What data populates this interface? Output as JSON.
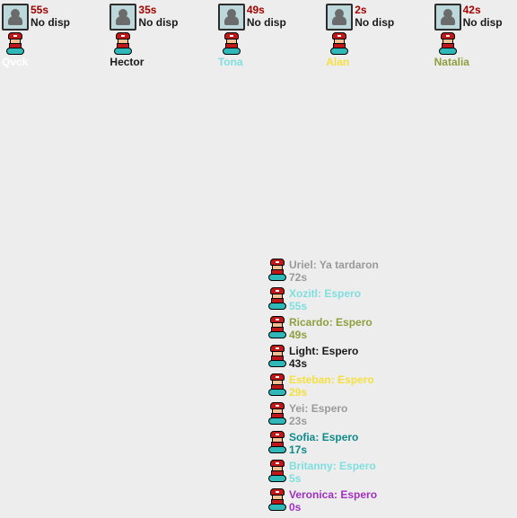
{
  "top_players": [
    {
      "time": "55s",
      "disp": "No disp",
      "name": "Qvck",
      "color": "c-white"
    },
    {
      "time": "35s",
      "disp": "No disp",
      "name": "Hector",
      "color": "c-black"
    },
    {
      "time": "49s",
      "disp": "No disp",
      "name": "Tona",
      "color": "c-cyan"
    },
    {
      "time": "2s",
      "disp": "No disp",
      "name": "Alan",
      "color": "c-yellow"
    },
    {
      "time": "42s",
      "disp": "No disp",
      "name": "Natalia",
      "color": "c-olive"
    }
  ],
  "queue": [
    {
      "name": "Uriel",
      "msg": "Ya tardaron",
      "time": "72s",
      "color": "c-gray"
    },
    {
      "name": "Xozitl",
      "msg": "Espero",
      "time": "55s",
      "color": "c-cyan"
    },
    {
      "name": "Ricardo",
      "msg": "Espero",
      "time": "49s",
      "color": "c-olive"
    },
    {
      "name": "Light",
      "msg": "Espero",
      "time": "43s",
      "color": "c-black"
    },
    {
      "name": "Esteban",
      "msg": "Espero",
      "time": "29s",
      "color": "c-yellow"
    },
    {
      "name": "Yei",
      "msg": "Espero",
      "time": "23s",
      "color": "c-gray"
    },
    {
      "name": "Sofia",
      "msg": "Espero",
      "time": "17s",
      "color": "c-teal"
    },
    {
      "name": "Britanny",
      "msg": "Espero",
      "time": "5s",
      "color": "c-cyan"
    },
    {
      "name": "Veronica",
      "msg": "Espero",
      "time": "0s",
      "color": "c-purple"
    }
  ]
}
